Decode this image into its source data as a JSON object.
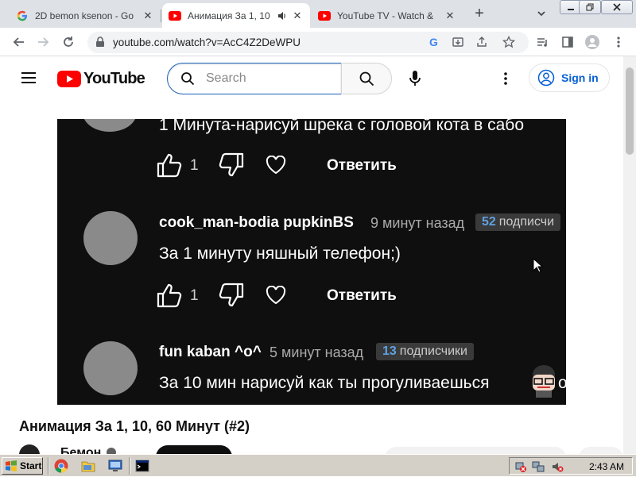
{
  "browser": {
    "tabs": [
      {
        "title": "2D bemon ksenon - Go",
        "favicon": "google-icon",
        "active": false
      },
      {
        "title": "Анимация За 1, 10",
        "favicon": "youtube-icon",
        "active": true,
        "audio": true
      },
      {
        "title": "YouTube TV - Watch & ",
        "favicon": "youtube-icon",
        "active": false
      }
    ],
    "close_glyph": "✕",
    "new_tab_glyph": "+",
    "window_controls": [
      "minimize",
      "restore",
      "close"
    ],
    "url": "youtube.com/watch?v=AcC4Z2DeWPU"
  },
  "youtube": {
    "logo_text": "YouTube",
    "search_placeholder": "Search",
    "sign_in_label": "Sign in",
    "video_title": "Анимация За 1, 10, 60 Минут (#2)",
    "channel_name": "Бемон"
  },
  "video_frame": {
    "comments": [
      {
        "body": "1 Минута-нарисуй шрека с головой кота в сабо",
        "likes": "1",
        "reply_label": "Ответить"
      },
      {
        "author": "cook_man-bodia pupkinBS",
        "time": "9 минут назад",
        "subs_count": "52",
        "subs_label": "подписчи",
        "body": "За 1 минуту няшный телефон;)",
        "likes": "1",
        "reply_label": "Ответить"
      },
      {
        "author": "fun kaban ^o^",
        "time": "5 минут назад",
        "subs_count": "13",
        "subs_label": "подписчики",
        "body": "За 10 мин нарисуй как ты прогуливаешься",
        "body_tail": "о"
      }
    ]
  },
  "taskbar": {
    "start_label": "Start",
    "clock": "2:43 AM"
  },
  "colors": {
    "youtube_red": "#ff0000",
    "link_blue": "#065fd4",
    "video_bg": "#0f0f0f",
    "subs_blue": "#5ea2e3"
  }
}
